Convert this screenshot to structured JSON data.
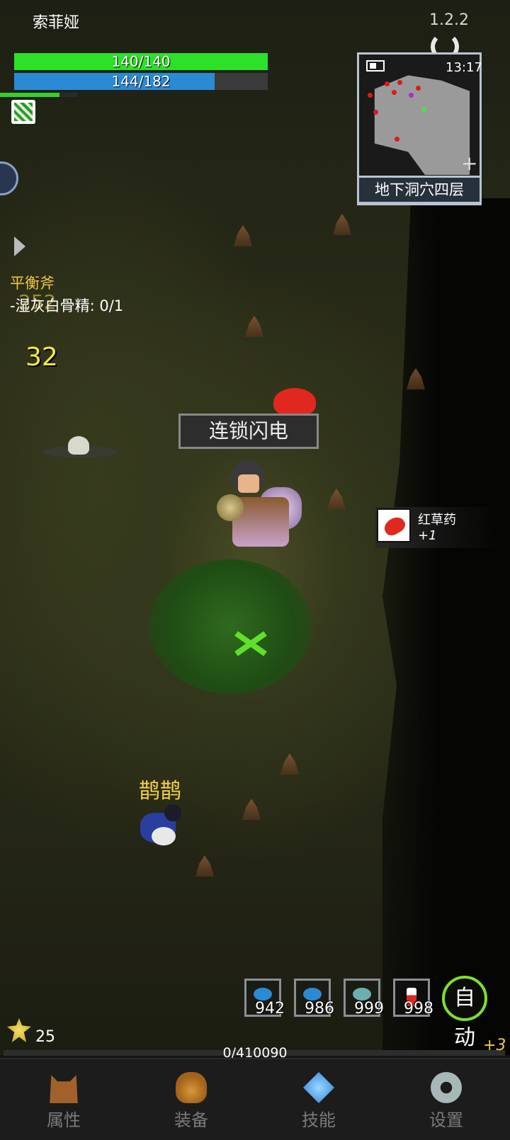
{
  "header": {
    "player_name": "索菲娅",
    "version": "1.2.2",
    "hp": {
      "current": 140,
      "max": 140,
      "label": "140/140",
      "color": "#2de028"
    },
    "mp": {
      "current": 144,
      "max": 182,
      "label": "144/182",
      "color": "#2a8ad4"
    }
  },
  "quest": {
    "title": "平衡斧",
    "line": "-湿灰白骨精: 0/1",
    "ghost_number": "252"
  },
  "floating_damage": "32",
  "minimap": {
    "time": "13:17",
    "floor_name": "地下洞穴四层",
    "icons": [
      "battery-icon",
      "plus-icon",
      "refresh-icon"
    ]
  },
  "skill_cast": "连锁闪电",
  "npc": {
    "name": "鹊鹊"
  },
  "loot": {
    "item_name": "红草药",
    "count": "+1",
    "accent": "#e0281e"
  },
  "quick_slots": [
    {
      "icon": "blue-fish-icon",
      "qty": "942",
      "color": "#2a8ad4"
    },
    {
      "icon": "blue-fish-icon",
      "qty": "986",
      "color": "#2a8ad4"
    },
    {
      "icon": "teal-fish-icon",
      "qty": "999",
      "color": "#6ab0b0"
    },
    {
      "icon": "potion-icon",
      "qty": "998",
      "color": "#e0281e"
    }
  ],
  "auto_button": "自动",
  "gold": "25",
  "experience": {
    "label": "0/410090",
    "gain": "+3",
    "fraction": 0
  },
  "bottom_nav": [
    {
      "label": "属性",
      "icon": "helmet-icon"
    },
    {
      "label": "装备",
      "icon": "bag-icon"
    },
    {
      "label": "技能",
      "icon": "gem-icon"
    },
    {
      "label": "设置",
      "icon": "gear-icon"
    }
  ]
}
